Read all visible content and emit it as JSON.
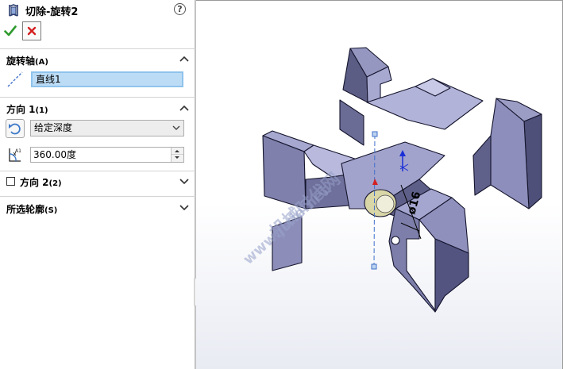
{
  "feature": {
    "title": "切除-旋转2",
    "help_label": "?"
  },
  "actions": {
    "ok": "confirm",
    "cancel": "cancel"
  },
  "sections": {
    "axis": {
      "title": "旋转轴",
      "shortcut": "(A)",
      "value": "直线1"
    },
    "direction1": {
      "title": "方向 1",
      "shortcut": "(1)",
      "end_condition": "给定深度",
      "angle": "360.00度"
    },
    "direction2": {
      "title": "方向 2",
      "shortcut": "(2)",
      "checked": false
    },
    "contours": {
      "title": "所选轮廓",
      "shortcut": "(S)"
    }
  },
  "viewport": {
    "dimension_label": "ø16",
    "watermark_line1": "机械时代网",
    "watermark_line2": "www.jixie.net"
  },
  "colors": {
    "part_face_light": "#b7b8da",
    "part_face_mid": "#9596bf",
    "part_face_dark": "#5b5c84",
    "part_edge": "#15152e",
    "selection_field": "#bcdcf6",
    "ok_green": "#2d9a2d",
    "cancel_red": "#d42020",
    "axis_blue": "#3f6fc9"
  }
}
